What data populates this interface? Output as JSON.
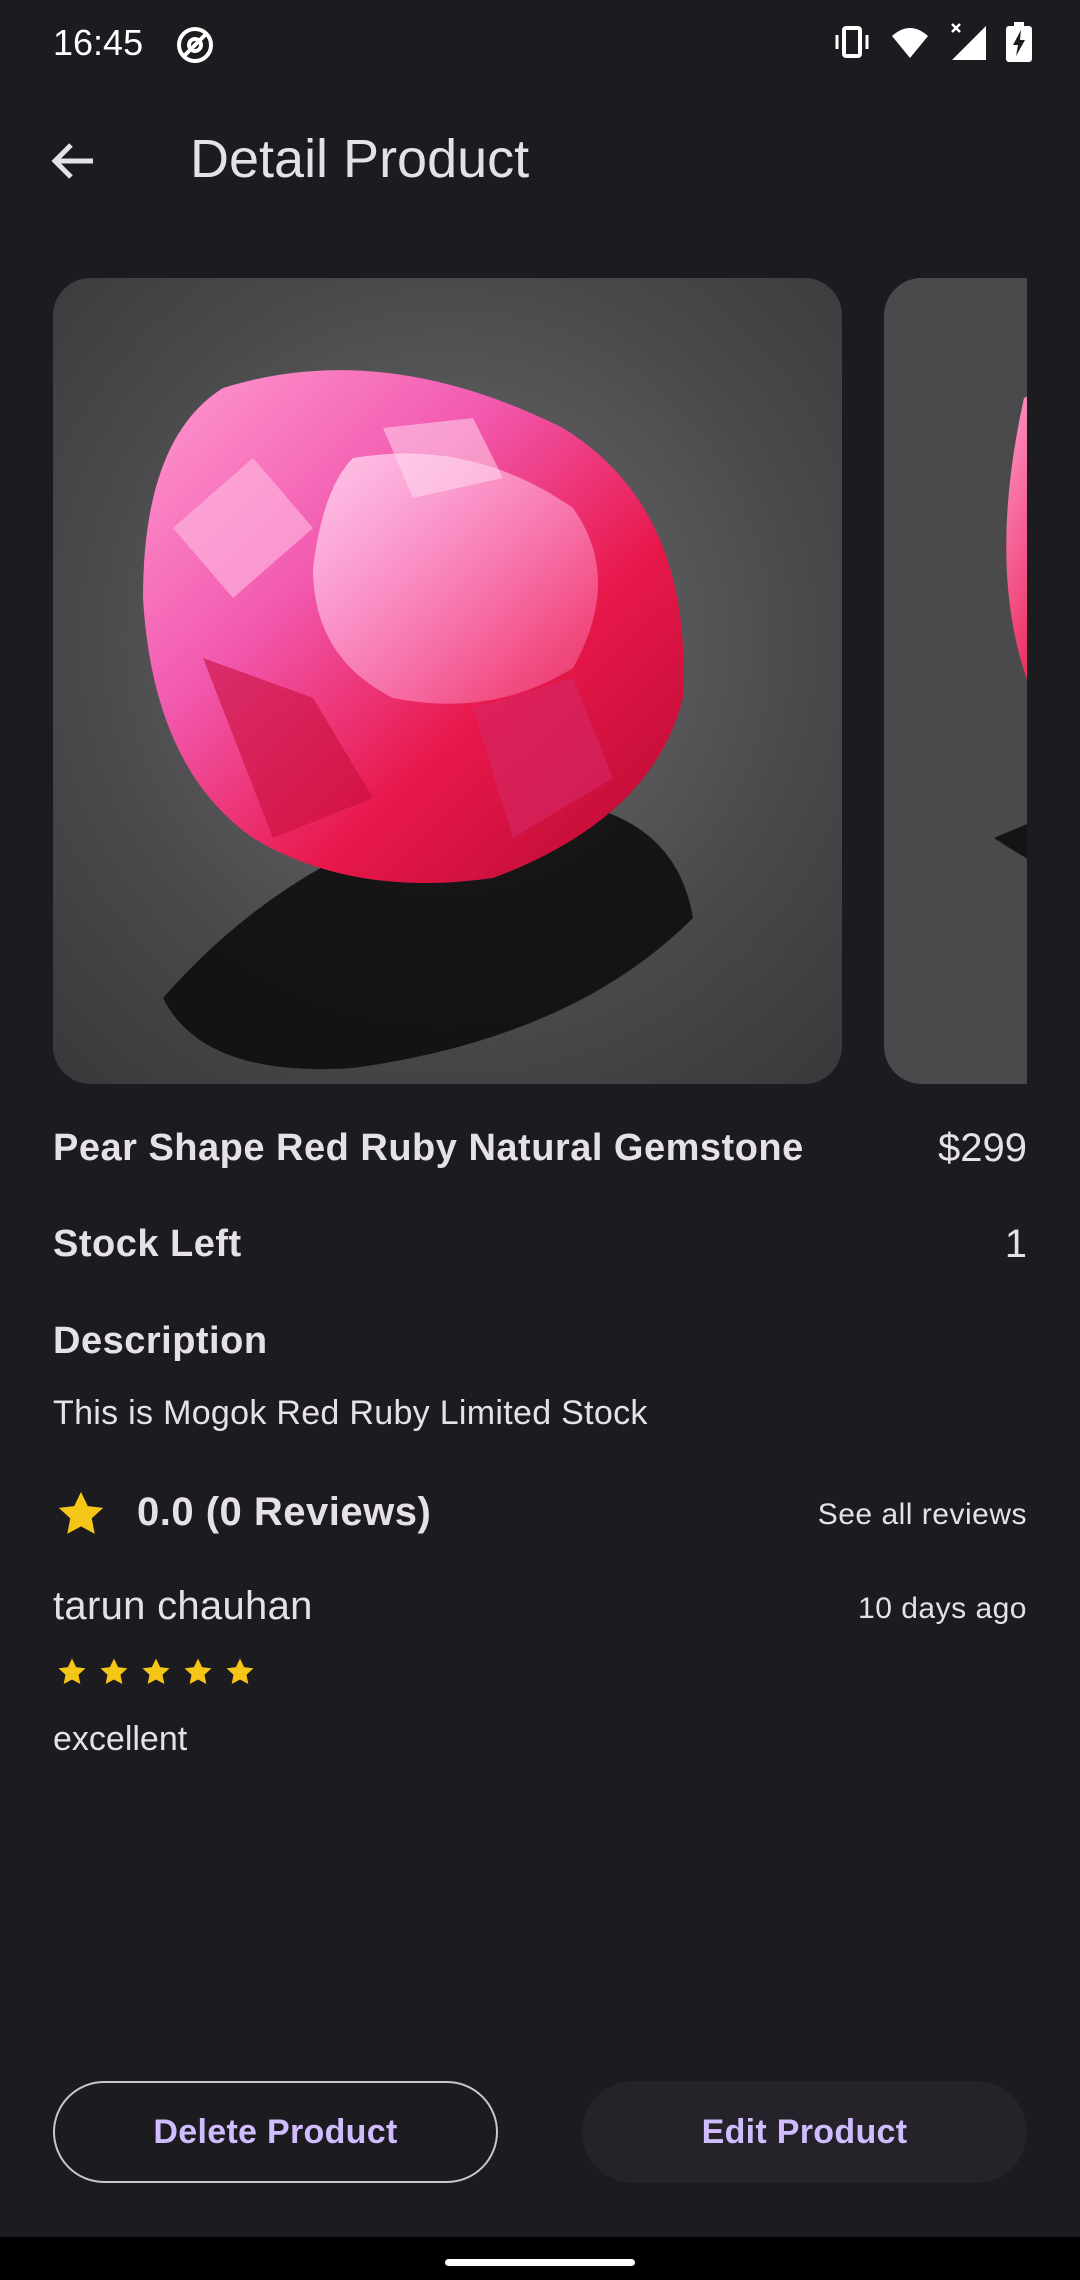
{
  "status_bar": {
    "time": "16:45",
    "icons": [
      "at-sign-icon",
      "vibrate-icon",
      "wifi-icon",
      "signal-icon",
      "battery-charging-icon"
    ]
  },
  "app_bar": {
    "title": "Detail Product",
    "back_icon": "arrow-left-icon"
  },
  "product": {
    "name": "Pear Shape Red Ruby Natural Gemstone",
    "price": "$299",
    "stock_label": "Stock Left",
    "stock_value": "1",
    "description_heading": "Description",
    "description": "This is Mogok Red Ruby Limited Stock",
    "images": [
      "red-ruby-photo-1",
      "red-ruby-photo-2"
    ]
  },
  "rating": {
    "summary": "0.0 (0 Reviews)",
    "see_all_label": "See all reviews",
    "star_color": "#f5c518"
  },
  "reviews": [
    {
      "author": "tarun chauhan",
      "date": "10 days ago",
      "stars": 5,
      "text": "excellent"
    }
  ],
  "actions": {
    "delete_label": "Delete Product",
    "edit_label": "Edit Product",
    "accent": "#d0bcff"
  }
}
